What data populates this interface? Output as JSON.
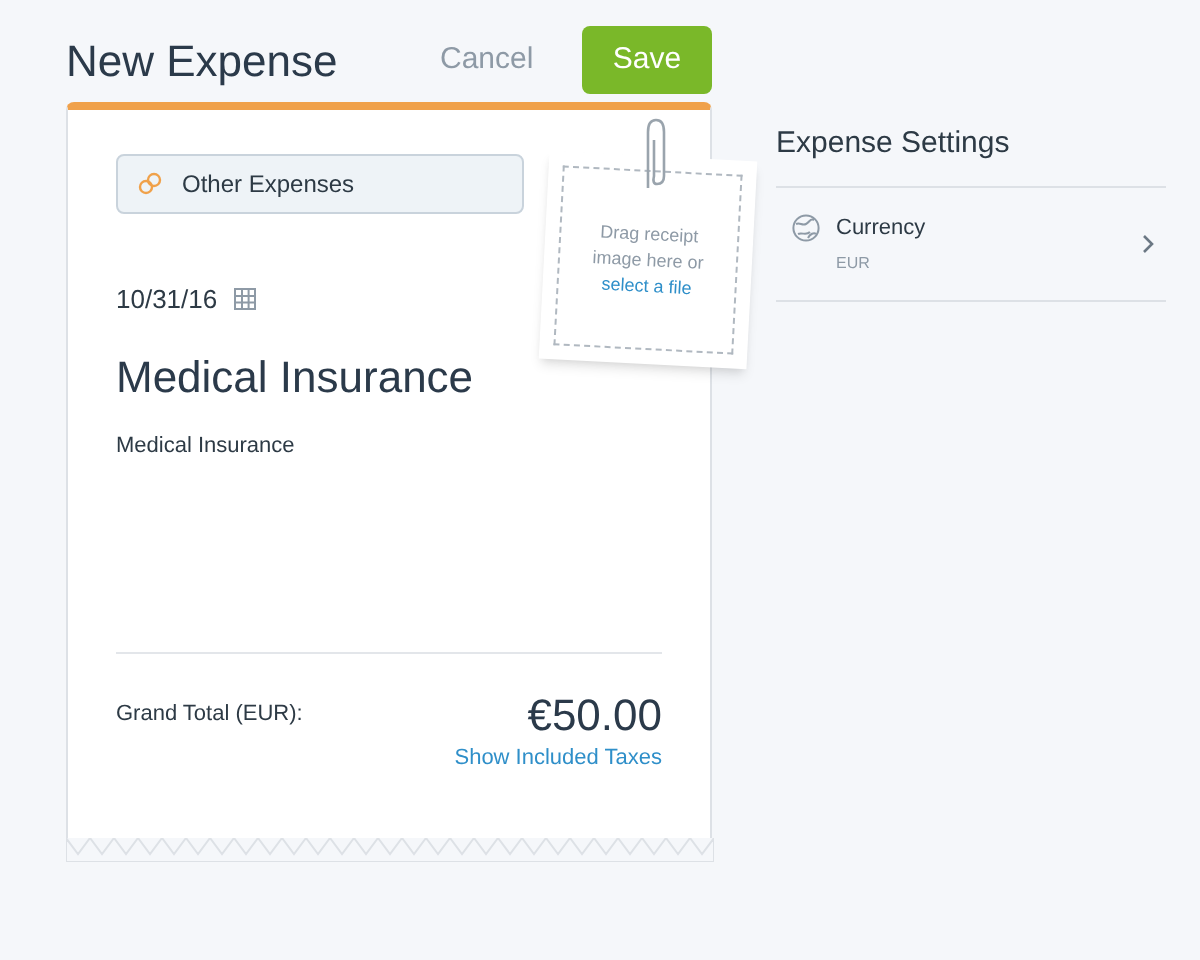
{
  "header": {
    "title": "New Expense",
    "cancel": "Cancel",
    "save": "Save"
  },
  "receipt": {
    "category": "Other Expenses",
    "date": "10/31/16",
    "title": "Medical Insurance",
    "description": "Medical Insurance",
    "total_label": "Grand Total (EUR):",
    "total": "€50.00",
    "taxes_link": "Show Included Taxes"
  },
  "dropzone": {
    "text": "Drag receipt image here or",
    "link": "select a file"
  },
  "settings": {
    "title": "Expense Settings",
    "items": [
      {
        "label": "Currency",
        "value": "EUR"
      }
    ]
  }
}
